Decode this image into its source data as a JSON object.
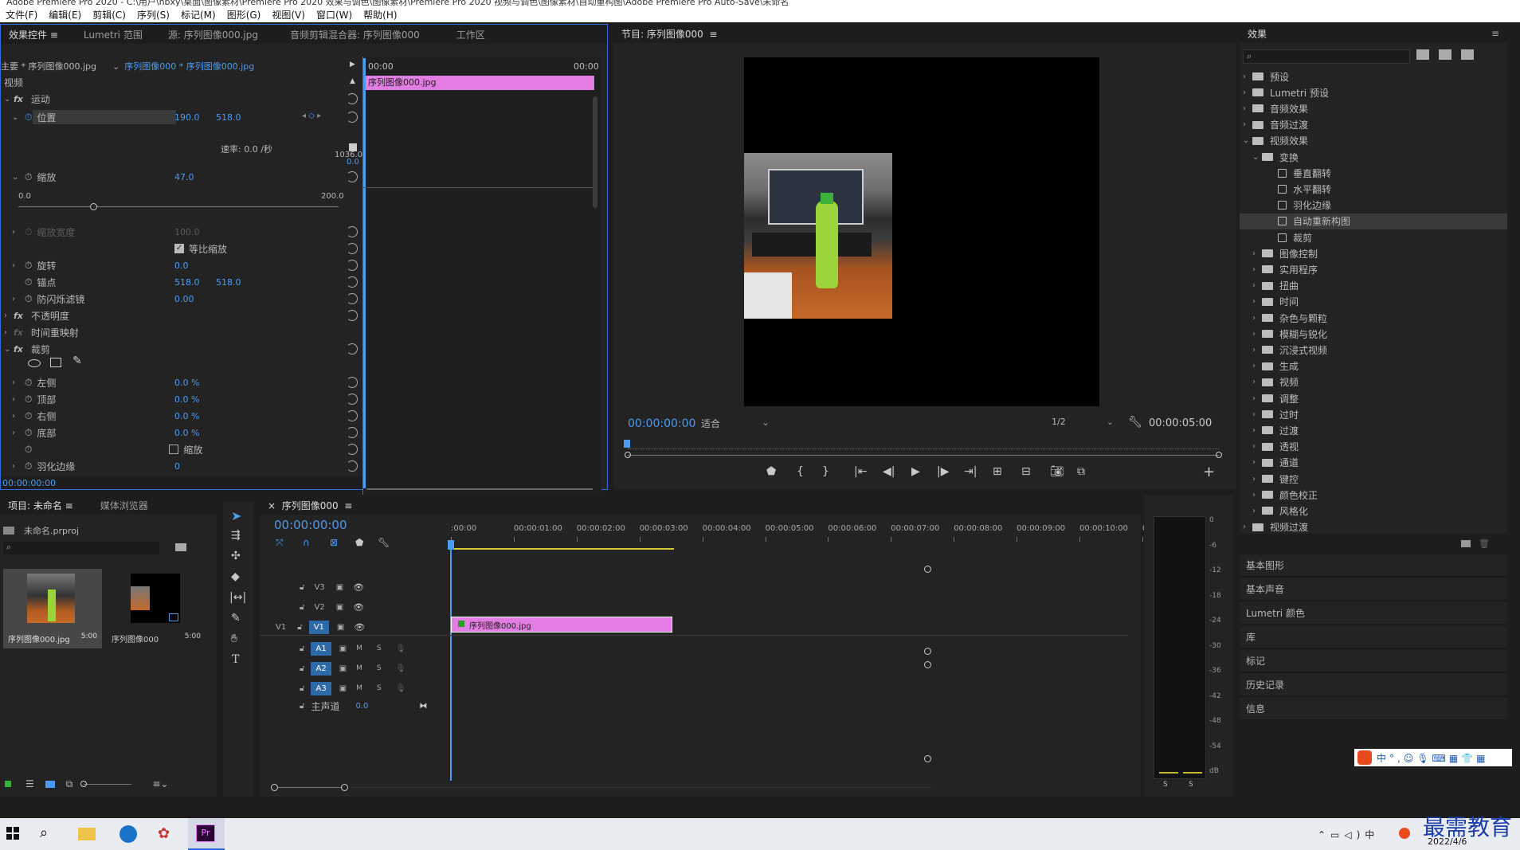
{
  "window": {
    "title": "Adobe Premiere Pro 2020 - C:\\用户\\hbxy\\桌面\\图像素材\\Premiere Pro 2020 效果与调色\\图像素材\\Premiere Pro 2020 视频与调色\\图像素材\\自动重构图\\Adobe Premiere Pro Auto-Save\\未命名"
  },
  "menu": [
    "文件(F)",
    "编辑(E)",
    "剪辑(C)",
    "序列(S)",
    "标记(M)",
    "图形(G)",
    "视图(V)",
    "窗口(W)",
    "帮助(H)"
  ],
  "effect_controls": {
    "tabs": [
      "效果控件",
      "Lumetri 范围",
      "源: 序列图像000.jpg",
      "音频剪辑混合器: 序列图像000",
      "工作区"
    ],
    "master": "主要 * 序列图像000.jpg",
    "clip": "序列图像000 * 序列图像000.jpg",
    "time_start": "00:00",
    "time_end": "00:00",
    "clip_bar_label": "序列图像000.jpg",
    "section_video": "视频",
    "motion": "运动",
    "position_label": "位置",
    "position_x": "190.0",
    "position_y": "518.0",
    "graph_max": "1036.0",
    "speed": "速率: 0.0 /秒",
    "graph_min": "0.0",
    "scale_label": "缩放",
    "scale_value": "47.0",
    "slider_min": "0.0",
    "slider_max": "200.0",
    "scale_width_label": "缩放宽度",
    "scale_width_value": "100.0",
    "uniform_scale": "等比缩放",
    "rotation_label": "旋转",
    "rotation_value": "0.0",
    "anchor_label": "锚点",
    "anchor_x": "518.0",
    "anchor_y": "518.0",
    "antiflicker_label": "防闪烁滤镜",
    "antiflicker_value": "0.00",
    "opacity": "不透明度",
    "time_remap": "时间重映射",
    "crop": "裁剪",
    "left_label": "左侧",
    "left_value": "0.0 %",
    "top_label": "顶部",
    "top_value": "0.0 %",
    "right_label": "右侧",
    "right_value": "0.0 %",
    "bottom_label": "底部",
    "bottom_value": "0.0 %",
    "zoom_label": "缩放",
    "feather_label": "羽化边缘",
    "feather_value": "0",
    "footer_time": "00:00:00:00",
    "next_label": "裁剪"
  },
  "program": {
    "title": "节目: 序列图像000",
    "timecode": "00:00:00:00",
    "fit": "适合",
    "resolution": "1/2",
    "duration": "00:00:05:00"
  },
  "effects": {
    "title": "效果",
    "items": [
      {
        "label": "预设",
        "level": 0,
        "type": "folder",
        "open": false
      },
      {
        "label": "Lumetri 预设",
        "level": 0,
        "type": "folder",
        "open": false
      },
      {
        "label": "音频效果",
        "level": 0,
        "type": "folder",
        "open": false
      },
      {
        "label": "音频过渡",
        "level": 0,
        "type": "folder",
        "open": false
      },
      {
        "label": "视频效果",
        "level": 0,
        "type": "folder",
        "open": true
      },
      {
        "label": "变换",
        "level": 1,
        "type": "folder",
        "open": true
      },
      {
        "label": "垂直翻转",
        "level": 2,
        "type": "fx"
      },
      {
        "label": "水平翻转",
        "level": 2,
        "type": "fx"
      },
      {
        "label": "羽化边缘",
        "level": 2,
        "type": "fx"
      },
      {
        "label": "自动重新构图",
        "level": 2,
        "type": "fx",
        "selected": true
      },
      {
        "label": "裁剪",
        "level": 2,
        "type": "fx"
      },
      {
        "label": "图像控制",
        "level": 1,
        "type": "folder",
        "open": false
      },
      {
        "label": "实用程序",
        "level": 1,
        "type": "folder",
        "open": false
      },
      {
        "label": "扭曲",
        "level": 1,
        "type": "folder",
        "open": false
      },
      {
        "label": "时间",
        "level": 1,
        "type": "folder",
        "open": false
      },
      {
        "label": "杂色与颗粒",
        "level": 1,
        "type": "folder",
        "open": false
      },
      {
        "label": "模糊与锐化",
        "level": 1,
        "type": "folder",
        "open": false
      },
      {
        "label": "沉浸式视频",
        "level": 1,
        "type": "folder",
        "open": false
      },
      {
        "label": "生成",
        "level": 1,
        "type": "folder",
        "open": false
      },
      {
        "label": "视频",
        "level": 1,
        "type": "folder",
        "open": false
      },
      {
        "label": "调整",
        "level": 1,
        "type": "folder",
        "open": false
      },
      {
        "label": "过时",
        "level": 1,
        "type": "folder",
        "open": false
      },
      {
        "label": "过渡",
        "level": 1,
        "type": "folder",
        "open": false
      },
      {
        "label": "透视",
        "level": 1,
        "type": "folder",
        "open": false
      },
      {
        "label": "通道",
        "level": 1,
        "type": "folder",
        "open": false
      },
      {
        "label": "键控",
        "level": 1,
        "type": "folder",
        "open": false
      },
      {
        "label": "颜色校正",
        "level": 1,
        "type": "folder",
        "open": false
      },
      {
        "label": "风格化",
        "level": 1,
        "type": "folder",
        "open": false
      },
      {
        "label": "视频过渡",
        "level": 0,
        "type": "folder",
        "open": false
      }
    ],
    "panels": [
      "基本图形",
      "基本声音",
      "Lumetri 颜色",
      "库",
      "标记",
      "历史记录",
      "信息"
    ]
  },
  "project": {
    "tabs": [
      "项目: 未命名",
      "媒体浏览器"
    ],
    "file": "未命名.prproj",
    "items": [
      {
        "name": "序列图像000.jpg",
        "duration": "5:00"
      },
      {
        "name": "序列图像000",
        "duration": "5:00"
      }
    ]
  },
  "timeline": {
    "tab": "序列图像000",
    "timecode": "00:00:00:00",
    "ruler": [
      ":00:00",
      "00:00:01:00",
      "00:00:02:00",
      "00:00:03:00",
      "00:00:04:00",
      "00:00:05:00",
      "00:00:06:00",
      "00:00:07:00",
      "00:00:08:00",
      "00:00:09:00",
      "00:00:10:00",
      "0"
    ],
    "video_tracks": [
      "V3",
      "V2",
      "V1"
    ],
    "audio_tracks": [
      "A1",
      "A2",
      "A3"
    ],
    "source_v1": "V1",
    "clip_label": "序列图像000.jpg",
    "master": "主声道",
    "master_value": "0.0"
  },
  "meter": {
    "labels": [
      "0",
      "-6",
      "-12",
      "-18",
      "-24",
      "-30",
      "-36",
      "-42",
      "-48",
      "-54",
      "dB"
    ],
    "solo": [
      "S",
      "S"
    ]
  },
  "taskbar": {
    "date": "2022/4/6",
    "watermark": "最需教育"
  }
}
